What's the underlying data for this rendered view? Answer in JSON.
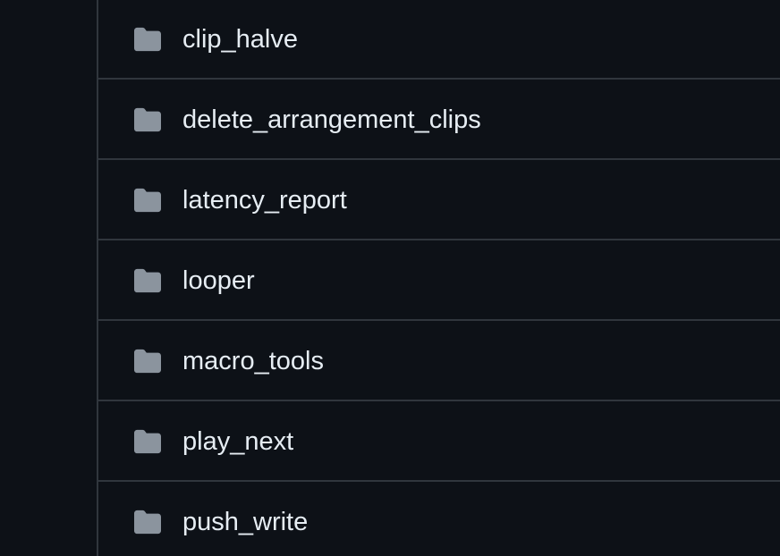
{
  "colors": {
    "background": "#0d1117",
    "divider": "#30363d",
    "folder_icon": "#8b949e",
    "text": "#e6edf3"
  },
  "file_list": {
    "items": [
      {
        "name": "clip_halve",
        "icon": "folder-icon"
      },
      {
        "name": "delete_arrangement_clips",
        "icon": "folder-icon"
      },
      {
        "name": "latency_report",
        "icon": "folder-icon"
      },
      {
        "name": "looper",
        "icon": "folder-icon"
      },
      {
        "name": "macro_tools",
        "icon": "folder-icon"
      },
      {
        "name": "play_next",
        "icon": "folder-icon"
      },
      {
        "name": "push_write",
        "icon": "folder-icon"
      }
    ]
  }
}
